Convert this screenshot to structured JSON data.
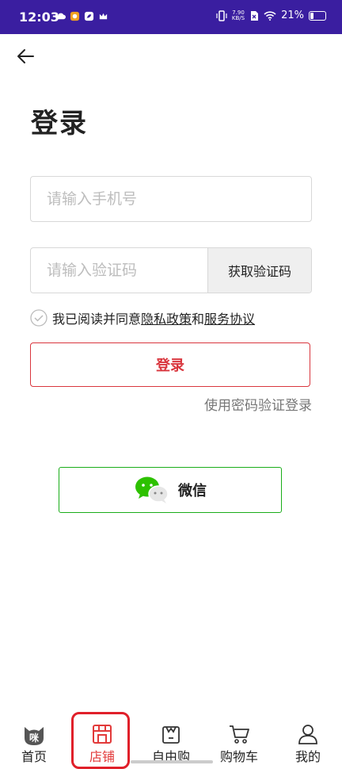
{
  "status_bar": {
    "time": "12:03",
    "net_speed_value": "7.90",
    "net_speed_unit": "KB/S",
    "battery_text": "21%",
    "battery_level": 0.21
  },
  "page": {
    "title": "登录"
  },
  "form": {
    "phone_placeholder": "请输入手机号",
    "code_placeholder": "请输入验证码",
    "get_code_label": "获取验证码",
    "agree_prefix": "我已阅读并同意",
    "privacy_link": "隐私政策",
    "and_text": "和",
    "service_link": "服务协议",
    "login_label": "登录",
    "password_login_link": "使用密码验证登录"
  },
  "third_party": {
    "wechat_label": "微信",
    "accent": "#1aad19"
  },
  "bottom_nav": {
    "items": [
      {
        "label": "首页",
        "icon": "cat-face-icon"
      },
      {
        "label": "店铺",
        "icon": "store-icon",
        "active": true
      },
      {
        "label": "自由购",
        "icon": "bag-icon"
      },
      {
        "label": "购物车",
        "icon": "cart-icon"
      },
      {
        "label": "我的",
        "icon": "user-icon"
      }
    ]
  },
  "colors": {
    "status_bar": "#3a1ea0",
    "accent_red": "#d9363e",
    "wechat_green": "#1aad19"
  }
}
